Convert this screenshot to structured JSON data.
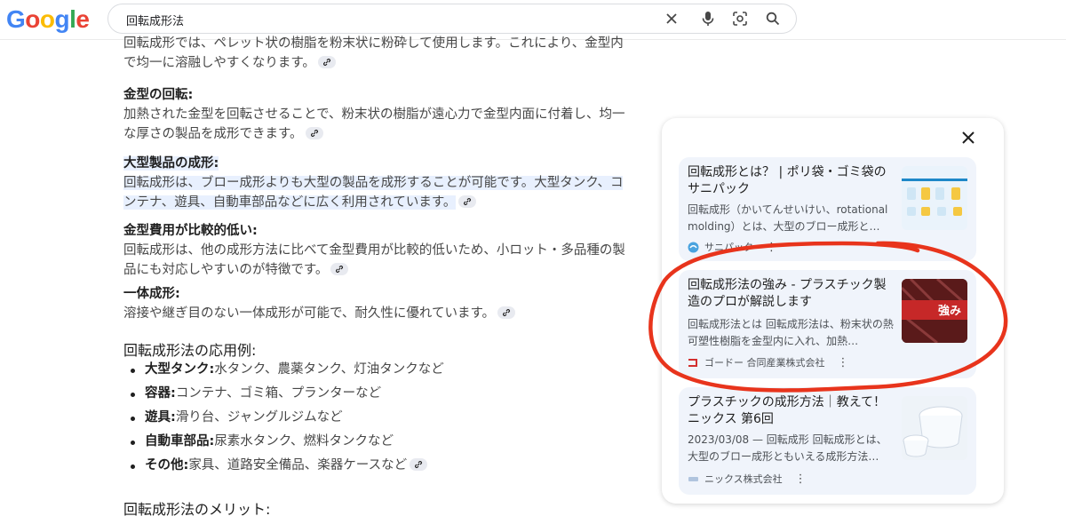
{
  "search": {
    "query": "回転成形法"
  },
  "main": {
    "intro": "回転成形では、ペレット状の樹脂を粉末状に粉砕して使用します。これにより、金型内で均一に溶融しやすくなります。",
    "blocks": [
      {
        "heading": "金型の回転:",
        "text": "加熱された金型を回転させることで、粉末状の樹脂が遠心力で金型内面に付着し、均一な厚さの製品を成形できます。"
      },
      {
        "heading": "大型製品の成形:",
        "text": "回転成形は、ブロー成形よりも大型の製品を成形することが可能です。大型タンク、コンテナ、遊具、自動車部品などに広く利用されています。"
      },
      {
        "heading": "金型費用が比較的低い:",
        "text": "回転成形は、他の成形方法に比べて金型費用が比較的低いため、小ロット・多品種の製品にも対応しやすいのが特徴です。"
      },
      {
        "heading": "一体成形:",
        "text": "溶接や継ぎ目のない一体成形が可能で、耐久性に優れています。"
      }
    ],
    "applications_title": "回転成形法の応用例:",
    "applications": [
      {
        "label": "大型タンク:",
        "text": "水タンク、農薬タンク、灯油タンクなど"
      },
      {
        "label": "容器:",
        "text": "コンテナ、ゴミ箱、プランターなど"
      },
      {
        "label": "遊具:",
        "text": "滑り台、ジャングルジムなど"
      },
      {
        "label": "自動車部品:",
        "text": "尿素水タンク、燃料タンクなど"
      },
      {
        "label": "その他:",
        "text": "家具、道路安全備品、楽器ケースなど"
      }
    ],
    "merits_title": "回転成形法のメリット:"
  },
  "panel": {
    "cards": [
      {
        "title": "回転成形とは？ | ポリ袋・ゴミ袋のサニパック",
        "snippet": "回転成形（かいてんせいけい、rotational molding）とは、大型のブロー成形と…",
        "source": "サニパック"
      },
      {
        "title": "回転成形法の強み - プラスチック製造のプロが解説します",
        "snippet": "回転成形法とは 回転成形法は、粉末状の熱可塑性樹脂を金型内に入れ、加熱…",
        "source": "ゴードー 合同産業株式会社",
        "thumb_text": "強み"
      },
      {
        "title": "プラスチックの成形方法｜教えて！ニックス 第6回",
        "snippet": "2023/03/08 — 回転成形 回転成形とは、大型のブロー成形ともいえる成形方法…",
        "source": "ニックス株式会社"
      }
    ]
  },
  "colors": {
    "highlight": "#e8f0fe",
    "annotation": "#e8341c"
  }
}
